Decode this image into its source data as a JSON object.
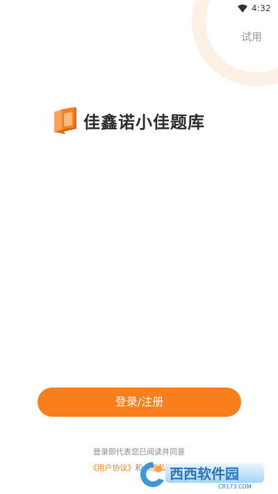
{
  "status_bar": {
    "time": "4:32",
    "wifi_icon": "wifi-icon"
  },
  "header": {
    "trial_label": "试用"
  },
  "logo": {
    "icon": "open-book-icon",
    "app_name": "佳鑫诺小佳题库"
  },
  "actions": {
    "login_label": "登录/注册"
  },
  "agreement": {
    "prefix": "登录即代表您已阅读并同意",
    "user_agreement": "《用户协议》",
    "conjunction": "和",
    "privacy_policy": "《隐私政策》"
  },
  "watermark": {
    "brand": "西西软件园",
    "url": "CR173.COM"
  },
  "colors": {
    "accent": "#f97f1d",
    "ring": "#fdf0e4",
    "muted_text": "#8a8a8a"
  }
}
